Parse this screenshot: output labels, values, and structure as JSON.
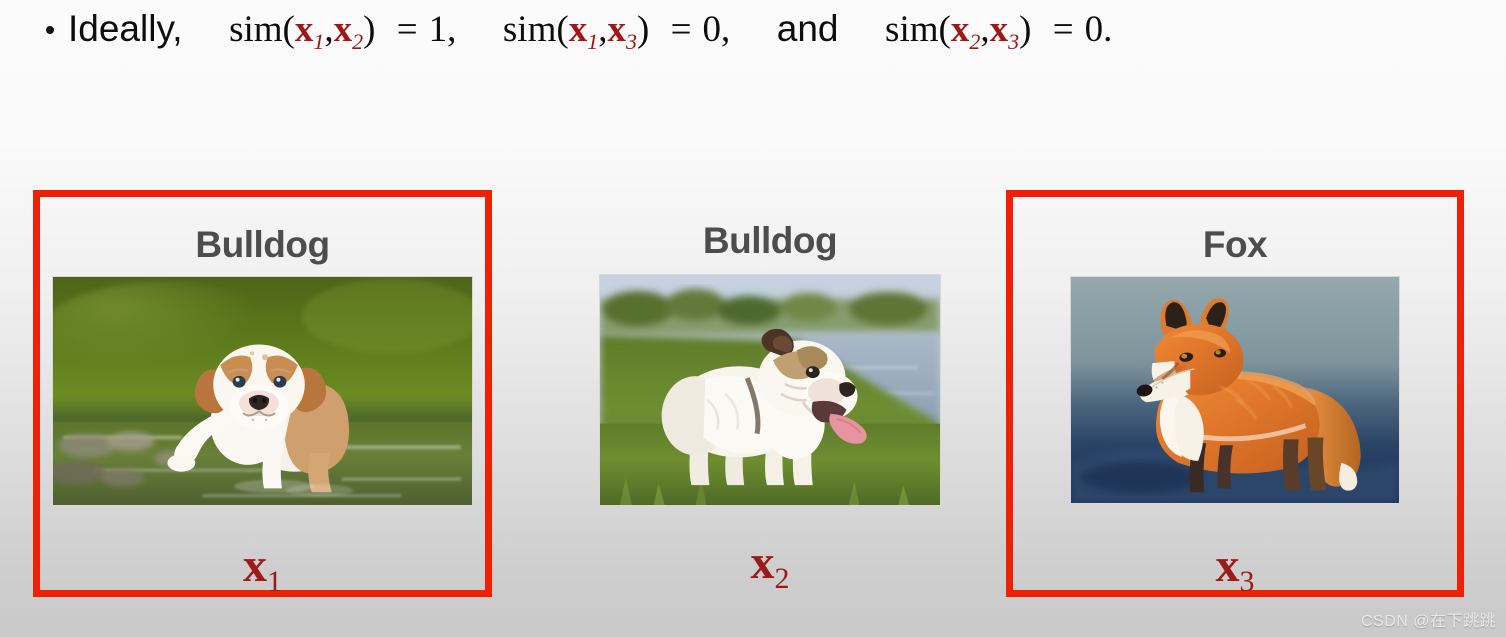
{
  "slide": {
    "background_top_color": "#fbfbfb",
    "background_bottom_color": "#c9c9c9",
    "accent_red": "#ef2006",
    "variable_red": "#9c1a17",
    "title_gray": "#4d4d4d"
  },
  "equation": {
    "bullet": "•",
    "lead_word": "Ideally,",
    "sim_label": "sim",
    "open_paren": "(",
    "close_paren": ")",
    "comma": ",",
    "equals": "=",
    "conjunction": "and",
    "period": ".",
    "terms": [
      {
        "var_a": "x",
        "sub_a": "1",
        "var_b": "x",
        "sub_b": "2",
        "value": "1",
        "trailing": ","
      },
      {
        "var_a": "x",
        "sub_a": "1",
        "var_b": "x",
        "sub_b": "3",
        "value": "0",
        "trailing": ","
      },
      {
        "var_a": "x",
        "sub_a": "2",
        "var_b": "x",
        "sub_b": "3",
        "value": "0",
        "trailing": "."
      }
    ],
    "full_text": "• Ideally,  sim(x1, x2) = 1,  sim(x1, x3) = 0,  and  sim(x2, x3) = 0."
  },
  "cards": [
    {
      "id": "card-1",
      "title": "Bulldog",
      "var_symbol": "x",
      "var_subscript": "1",
      "highlighted": true,
      "image_alt": "bulldog-puppy-in-water"
    },
    {
      "id": "card-2",
      "title": "Bulldog",
      "var_symbol": "x",
      "var_subscript": "2",
      "highlighted": false,
      "image_alt": "adult-bulldog-on-grass-by-lake"
    },
    {
      "id": "card-3",
      "title": "Fox",
      "var_symbol": "x",
      "var_subscript": "3",
      "highlighted": true,
      "image_alt": "red-fox-standing-in-snow"
    }
  ],
  "watermark": {
    "text": "CSDN @在下跳跳"
  }
}
